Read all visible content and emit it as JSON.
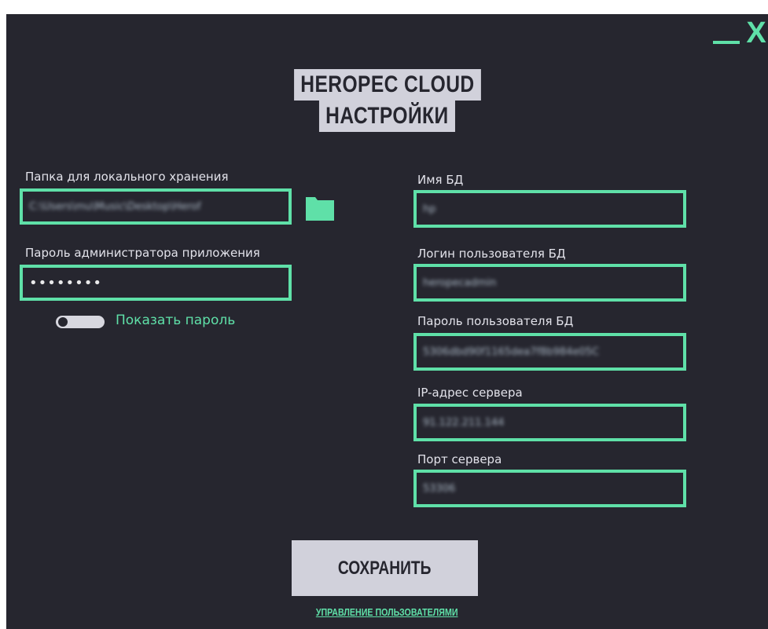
{
  "window_controls": {
    "minimize_icon": "minimize-icon",
    "close_label": "X"
  },
  "title": {
    "line1": "HEROPEC CLOUD",
    "line2": "НАСТРОЙКИ"
  },
  "left": {
    "storage_folder_label": "Папка для локального хранения",
    "storage_folder_value": "C:\\Users\\mu\\Music\\Desktop\\Herof",
    "folder_icon": "folder-icon",
    "admin_password_label": "Пароль администратора приложения",
    "admin_password_value": "••••••••",
    "show_password_label": "Показать пароль"
  },
  "right": {
    "db_name_label": "Имя БД",
    "db_name_value": "hp",
    "db_login_label": "Логин пользователя БД",
    "db_login_value": "heropecadmin",
    "db_password_label": "Пароль пользователя БД",
    "db_password_value": "5306dbd90f1165dea7f8b984e05C",
    "server_ip_label": "IP-адрес сервера",
    "server_ip_value": "91.122.211.144",
    "server_port_label": "Порт сервера",
    "server_port_value": "53306"
  },
  "actions": {
    "save_label": "СОХРАНИТЬ",
    "manage_users_label": "УПРАВЛЕНИЕ ПОЛЬЗОВАТЕЛЯМИ"
  },
  "colors": {
    "accent": "#5fe0a8",
    "background": "#26262f",
    "panel_light": "#d1d1db",
    "text": "#e2e2ea"
  }
}
